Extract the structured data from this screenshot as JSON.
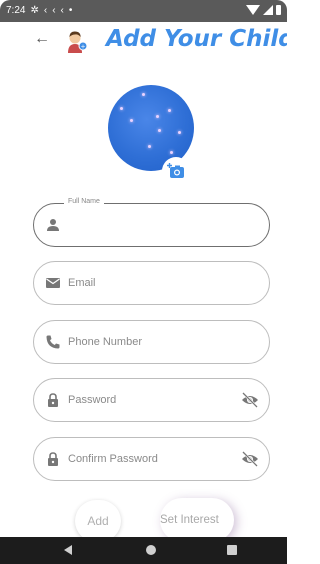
{
  "status_bar": {
    "time": "7:24",
    "icons": [
      "settings-icon",
      "chevron-icon",
      "chevron-icon",
      "chevron-icon",
      "dot-icon",
      "wifi-icon",
      "signal-icon",
      "battery-icon"
    ]
  },
  "header": {
    "title": "Add Your Child",
    "back_icon": "arrow-left-icon",
    "avatar_icon": "child-avatar-icon"
  },
  "profile": {
    "camera_icon": "add-photo-icon"
  },
  "form": {
    "full_name": {
      "label": "Full Name",
      "value": "",
      "icon": "person-icon"
    },
    "email": {
      "placeholder": "Email",
      "icon": "email-icon"
    },
    "phone": {
      "placeholder": "Phone Number",
      "icon": "phone-icon"
    },
    "password": {
      "placeholder": "Password",
      "icon": "lock-icon",
      "toggle_icon": "eye-off-icon"
    },
    "confirm_password": {
      "placeholder": "Confirm Password",
      "icon": "lock-icon",
      "toggle_icon": "eye-off-icon"
    }
  },
  "actions": {
    "add_label": "Add",
    "interest_label": "Set Interest"
  },
  "colors": {
    "accent": "#3f8ee6",
    "status_bar": "#5a5a5a",
    "nav_bar": "#1c1c1c"
  }
}
